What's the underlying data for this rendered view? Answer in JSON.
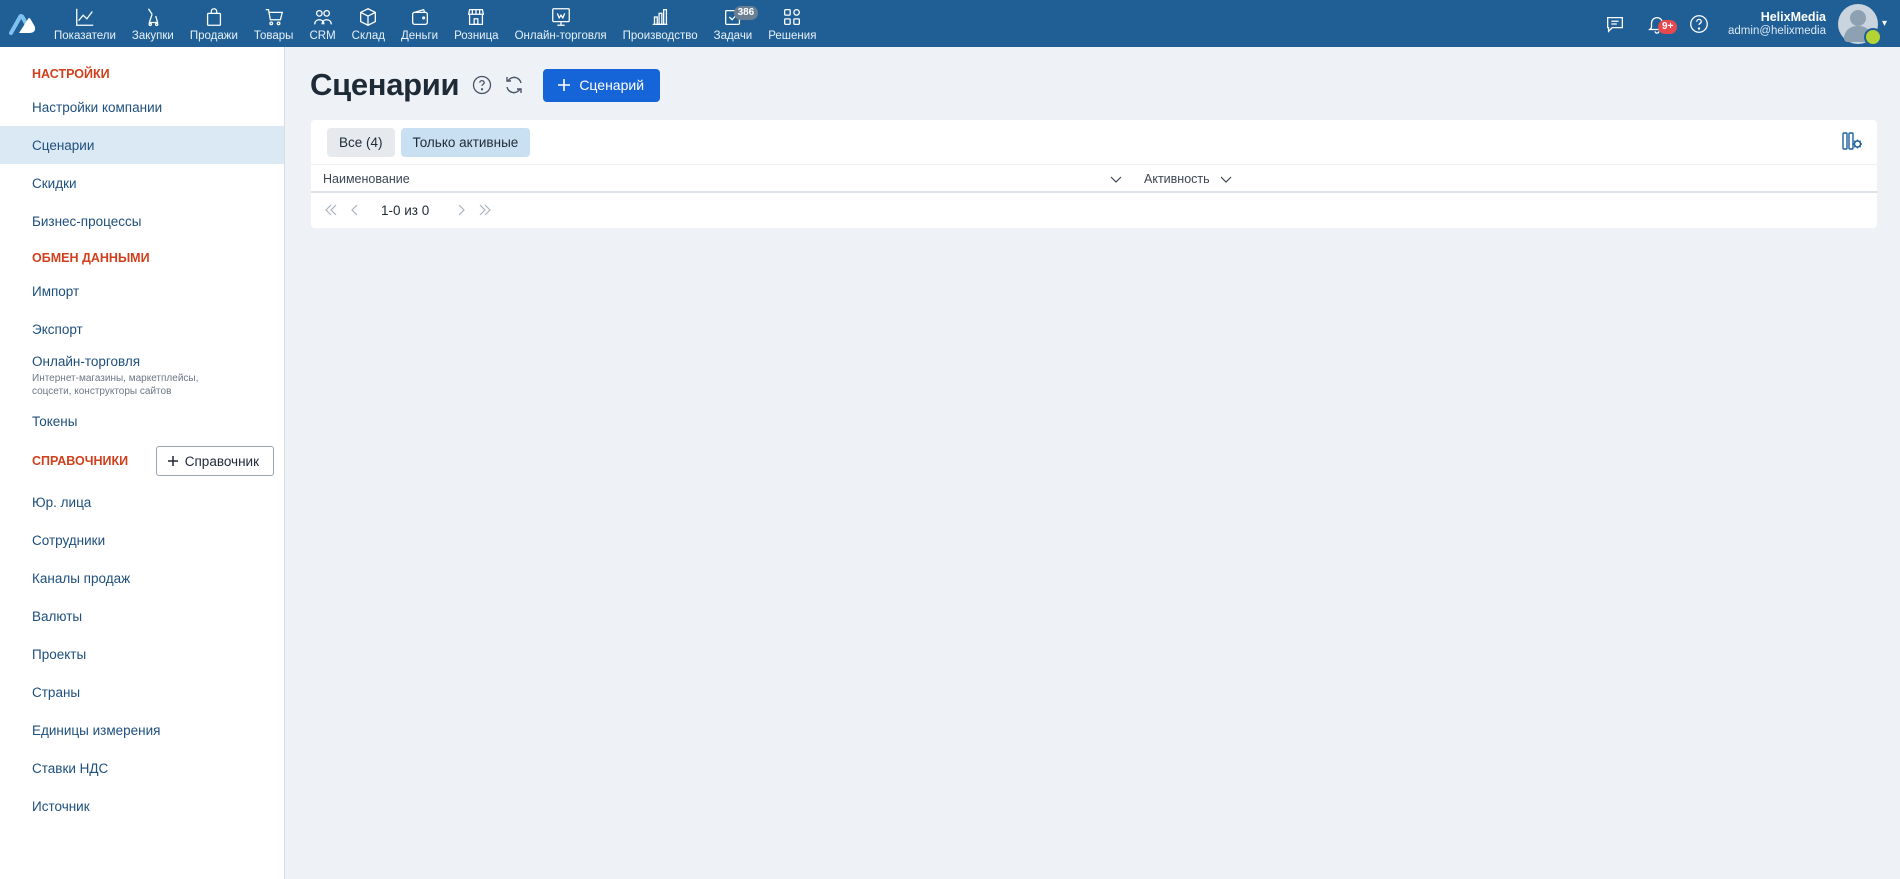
{
  "topbar": {
    "nav": [
      {
        "label": "Показатели",
        "icon": "chart-line-icon"
      },
      {
        "label": "Закупки",
        "icon": "purchases-icon"
      },
      {
        "label": "Продажи",
        "icon": "shopping-bag-icon"
      },
      {
        "label": "Товары",
        "icon": "cart-icon"
      },
      {
        "label": "CRM",
        "icon": "people-icon"
      },
      {
        "label": "Склад",
        "icon": "box-icon"
      },
      {
        "label": "Деньги",
        "icon": "wallet-icon"
      },
      {
        "label": "Розница",
        "icon": "store-icon"
      },
      {
        "label": "Онлайн-торговля",
        "icon": "online-store-icon"
      },
      {
        "label": "Производство",
        "icon": "factory-icon"
      },
      {
        "label": "Задачи",
        "icon": "tasks-icon",
        "badge": "386"
      },
      {
        "label": "Решения",
        "icon": "apps-grid-icon"
      }
    ],
    "notifications_badge": "9+",
    "user": {
      "name": "HelixMedia",
      "email": "admin@helixmedia"
    }
  },
  "sidebar": {
    "settings_header": "НАСТРОЙКИ",
    "settings_items": [
      {
        "label": "Настройки компании"
      },
      {
        "label": "Сценарии"
      },
      {
        "label": "Скидки"
      },
      {
        "label": "Бизнес-процессы"
      }
    ],
    "exchange_header": "ОБМЕН ДАННЫМИ",
    "exchange_items": [
      {
        "label": "Импорт"
      },
      {
        "label": "Экспорт"
      }
    ],
    "online_trade": {
      "label": "Онлайн-торговля",
      "description": "Интернет-магазины, маркетплейсы, соцсети, конструкторы сайтов"
    },
    "tokens_label": "Токены",
    "dict_header": "СПРАВОЧНИКИ",
    "dict_button": "Справочник",
    "dict_items": [
      {
        "label": "Юр. лица"
      },
      {
        "label": "Сотрудники"
      },
      {
        "label": "Каналы продаж"
      },
      {
        "label": "Валюты"
      },
      {
        "label": "Проекты"
      },
      {
        "label": "Страны"
      },
      {
        "label": "Единицы измерения"
      },
      {
        "label": "Ставки НДС"
      },
      {
        "label": "Источник"
      }
    ]
  },
  "main": {
    "title": "Сценарии",
    "add_button": "Сценарий",
    "filters": {
      "all": "Все (4)",
      "active_only": "Только активные"
    },
    "columns": {
      "name": "Наименование",
      "activity": "Активность"
    },
    "pager_text": "1-0 из 0"
  },
  "colors": {
    "topbar": "#1f5f96",
    "accent": "#1665d8",
    "section_header": "#d1401c",
    "active_item": "#dbe9f5"
  }
}
